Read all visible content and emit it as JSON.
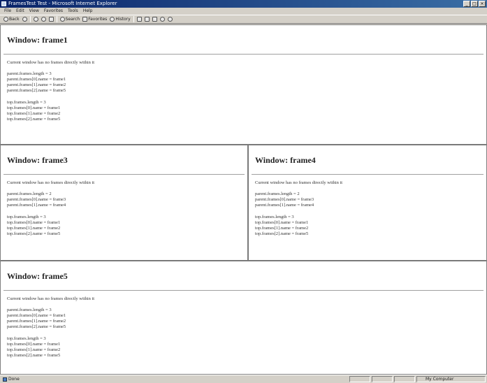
{
  "window": {
    "title": "FramesTest Test - Microsoft Internet Explorer"
  },
  "menu": [
    "File",
    "Edit",
    "View",
    "Favorites",
    "Tools",
    "Help"
  ],
  "toolbar": {
    "back": "Back",
    "search": "Search",
    "favorites": "Favorites",
    "history": "History"
  },
  "frames": {
    "frame1": {
      "title": "Window: frame1",
      "note": "Current window has no frames directly within it",
      "parent": [
        "parent.frames.length = 3",
        "parent.frames[0].name = frame1",
        "parent.frames[1].name = frame2",
        "parent.frames[2].name = frame5"
      ],
      "top": [
        "top.frames.length = 3",
        "top.frames[0].name = frame1",
        "top.frames[1].name = frame2",
        "top.frames[2].name = frame5"
      ]
    },
    "frame3": {
      "title": "Window: frame3",
      "note": "Current window has no frames directly within it",
      "parent": [
        "parent.frames.length = 2",
        "parent.frames[0].name = frame3",
        "parent.frames[1].name = frame4"
      ],
      "top": [
        "top.frames.length = 3",
        "top.frames[0].name = frame1",
        "top.frames[1].name = frame2",
        "top.frames[2].name = frame5"
      ]
    },
    "frame4": {
      "title": "Window: frame4",
      "note": "Current window has no frames directly within it",
      "parent": [
        "parent.frames.length = 2",
        "parent.frames[0].name = frame3",
        "parent.frames[1].name = frame4"
      ],
      "top": [
        "top.frames.length = 3",
        "top.frames[0].name = frame1",
        "top.frames[1].name = frame2",
        "top.frames[2].name = frame5"
      ]
    },
    "frame5": {
      "title": "Window: frame5",
      "note": "Current window has no frames directly within it",
      "parent": [
        "parent.frames.length = 3",
        "parent.frames[0].name = frame1",
        "parent.frames[1].name = frame2",
        "parent.frames[2].name = frame5"
      ],
      "top": [
        "top.frames.length = 3",
        "top.frames[0].name = frame1",
        "top.frames[1].name = frame2",
        "top.frames[2].name = frame5"
      ]
    }
  },
  "status": {
    "left": "Done",
    "right": "My Computer"
  }
}
